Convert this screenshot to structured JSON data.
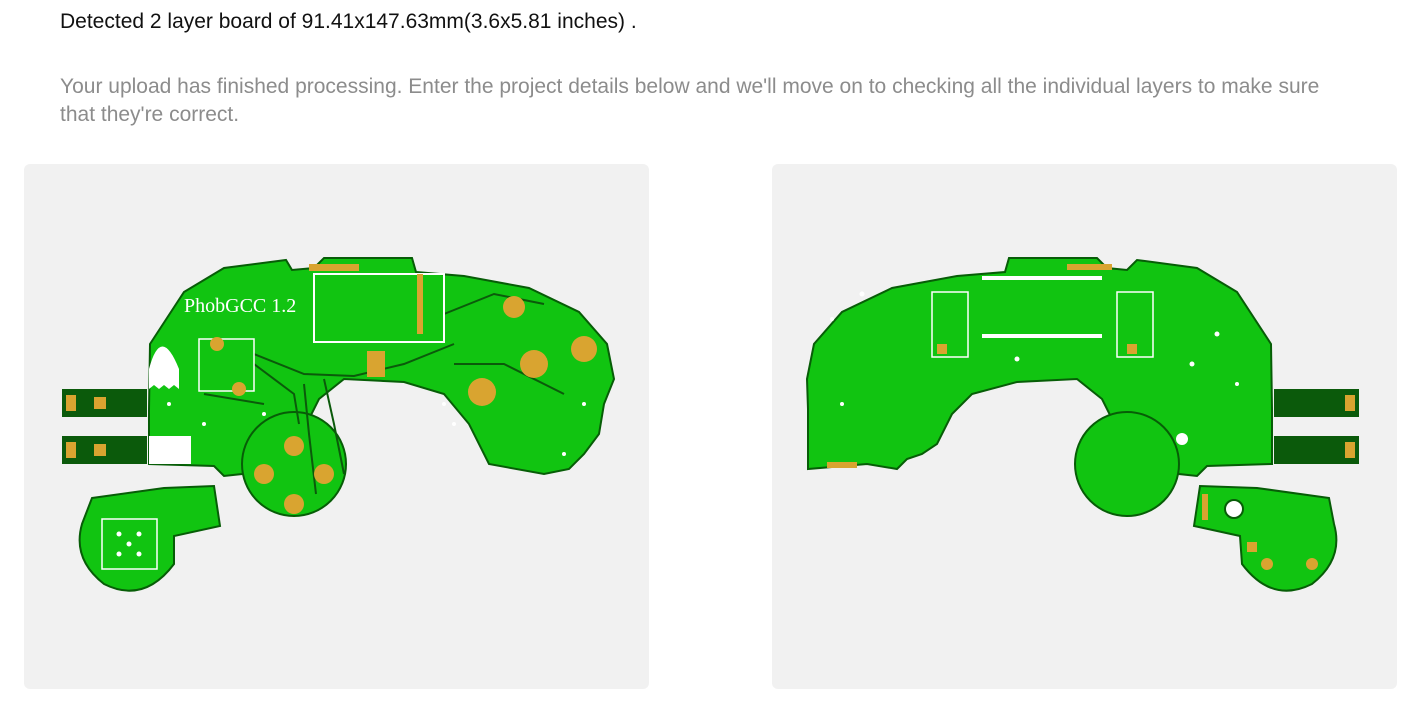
{
  "board_summary": "Detected 2 layer board of 91.41x147.63mm(3.6x5.81 inches) .",
  "upload_message": "Your upload has finished processing. Enter the project details below and we'll move on to checking all the individual layers to make sure that they're correct.",
  "colors": {
    "pcb_green": "#11c411",
    "trace_dark": "#0b5a0b",
    "pad_gold": "#d9a430",
    "panel_bg": "#f1f1f1",
    "info_text": "#8c8c8c"
  },
  "previews": {
    "top": {
      "silkscreen_title": "PhobGCC 1.2"
    },
    "bottom": {
      "silkscreen_title": ""
    }
  }
}
